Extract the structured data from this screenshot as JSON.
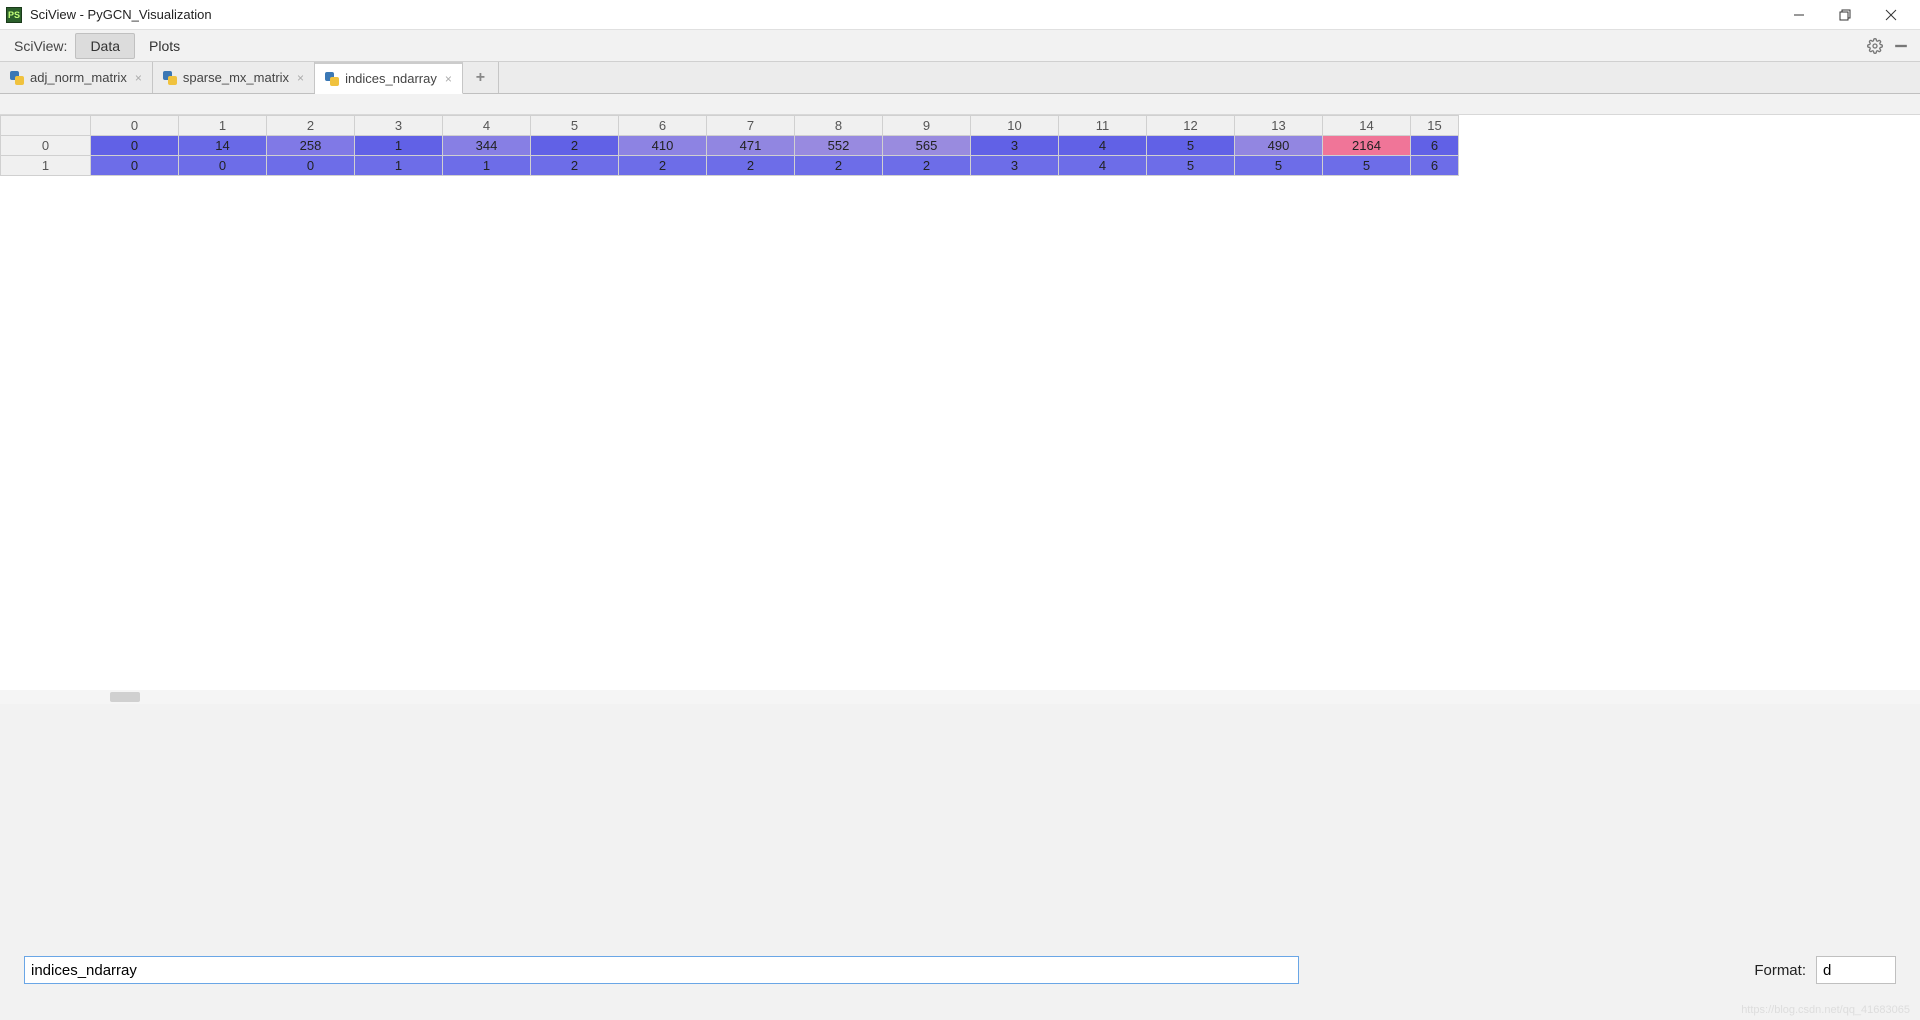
{
  "window": {
    "title": "SciView - PyGCN_Visualization",
    "app_icon_label": "PS"
  },
  "menubar": {
    "label": "SciView:",
    "items": [
      "Data",
      "Plots"
    ],
    "active_index": 0
  },
  "tabs": [
    {
      "label": "adj_norm_matrix",
      "active": false
    },
    {
      "label": "sparse_mx_matrix",
      "active": false
    },
    {
      "label": "indices_ndarray",
      "active": true
    }
  ],
  "table": {
    "columns": [
      "0",
      "1",
      "2",
      "3",
      "4",
      "5",
      "6",
      "7",
      "8",
      "9",
      "10",
      "11",
      "12",
      "13",
      "14",
      "15"
    ],
    "row_headers": [
      "0",
      "1"
    ],
    "rows": [
      {
        "values": [
          "0",
          "14",
          "258",
          "1",
          "344",
          "2",
          "410",
          "471",
          "552",
          "565",
          "3",
          "4",
          "5",
          "490",
          "2164",
          "6"
        ],
        "colors": [
          "#6161e6",
          "#6969e7",
          "#8079e6",
          "#6161e6",
          "#877fe4",
          "#6161e6",
          "#8d83e3",
          "#9186e1",
          "#988ae0",
          "#998bdf",
          "#6161e6",
          "#6161e6",
          "#6161e6",
          "#9286e1",
          "#f07598",
          "#6161e6"
        ]
      },
      {
        "values": [
          "0",
          "0",
          "0",
          "1",
          "1",
          "2",
          "2",
          "2",
          "2",
          "2",
          "3",
          "4",
          "5",
          "5",
          "5",
          "6"
        ],
        "colors": [
          "#6d6de8",
          "#6d6de8",
          "#6d6de8",
          "#6d6de8",
          "#6d6de8",
          "#6d6de8",
          "#6d6de8",
          "#6d6de8",
          "#6d6de8",
          "#6d6de8",
          "#6d6de8",
          "#6d6de8",
          "#6d6de8",
          "#6d6de8",
          "#6d6de8",
          "#6d6de8"
        ]
      }
    ]
  },
  "bottom": {
    "variable_name": "indices_ndarray",
    "format_label": "Format:",
    "format_value": "d"
  },
  "watermark": "https://blog.csdn.net/qq_41683065"
}
